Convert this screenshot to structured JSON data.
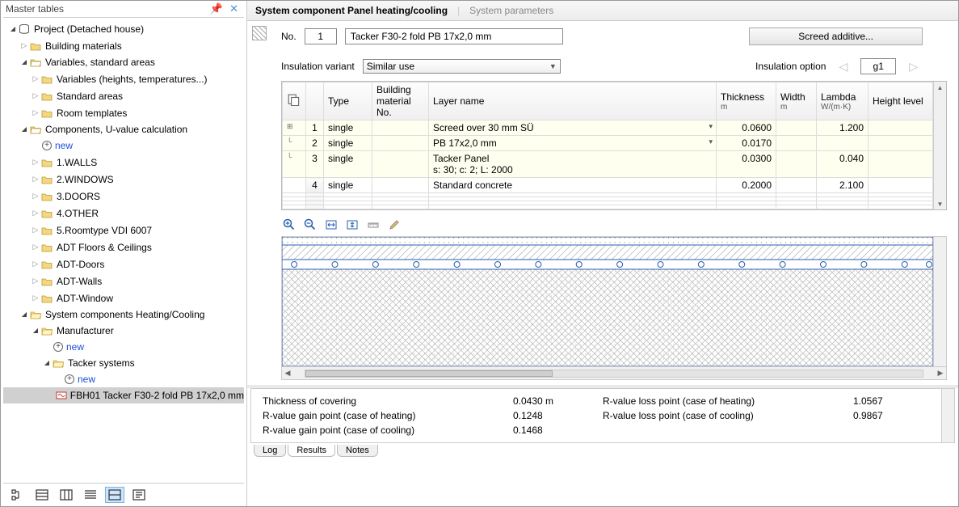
{
  "sidebar": {
    "title": "Master tables",
    "project": "Project (Detached house)",
    "building_materials": "Building materials",
    "variables_std": "Variables, standard areas",
    "variables_heights": "Variables (heights, temperatures...)",
    "standard_areas": "Standard areas",
    "room_templates": "Room templates",
    "components_uval": "Components, U-value calculation",
    "new1": "new",
    "walls": "1.WALLS",
    "windows": "2.WINDOWS",
    "doors": "3.DOORS",
    "other": "4.OTHER",
    "roomtype": "5.Roomtype VDI 6007",
    "adt_floors": "ADT Floors & Ceilings",
    "adt_doors": "ADT-Doors",
    "adt_walls": "ADT-Walls",
    "adt_window": "ADT-Window",
    "sys_comp": "System components Heating/Cooling",
    "manufacturer": "Manufacturer",
    "new2": "new",
    "tacker_systems": "Tacker systems",
    "new3": "new",
    "selected_item": "FBH01 Tacker F30-2 fold PB 17x2,0 mm"
  },
  "tabs": {
    "panel": "System component Panel heating/cooling",
    "params": "System parameters"
  },
  "form": {
    "no_label": "No.",
    "no_value": "1",
    "name_value": "Tacker F30-2 fold PB 17x2,0 mm",
    "screed_btn": "Screed additive...",
    "ins_var_label": "Insulation variant",
    "ins_var_value": "Similar use",
    "ins_opt_label": "Insulation option",
    "ins_opt_value": "g1"
  },
  "grid": {
    "headers": {
      "type": "Type",
      "mat": "Building material No.",
      "layer": "Layer name",
      "thick": "Thickness",
      "thick_u": "m",
      "width": "Width",
      "width_u": "m",
      "lambda": "Lambda",
      "lambda_u": "W/(m·K)",
      "height": "Height level"
    },
    "rows": [
      {
        "n": "1",
        "type": "single",
        "mat": "",
        "layer": "Screed over 30 mm SÜ",
        "thick": "0.0600",
        "width": "",
        "lambda": "1.200",
        "height": "",
        "sel": true,
        "dd": true
      },
      {
        "n": "2",
        "type": "single",
        "mat": "",
        "layer": "PB 17x2,0 mm",
        "thick": "0.0170",
        "width": "",
        "lambda": "",
        "height": "",
        "sel": true,
        "dd": true
      },
      {
        "n": "3",
        "type": "single",
        "mat": "",
        "layer": "Tacker Panel\ns: 30;  c: 2;  L: 2000",
        "thick": "0.0300",
        "width": "",
        "lambda": "0.040",
        "height": "",
        "sel": true
      },
      {
        "n": "4",
        "type": "single",
        "mat": "",
        "layer": "Standard concrete",
        "thick": "0.2000",
        "width": "",
        "lambda": "2.100",
        "height": ""
      }
    ]
  },
  "results": {
    "thick_label": "Thickness of covering",
    "thick_val": "0.0430 m",
    "r_gain_heat_l": "R-value gain point (case of heating)",
    "r_gain_heat_v": "0.1248",
    "r_gain_cool_l": "R-value gain point (case of cooling)",
    "r_gain_cool_v": "0.1468",
    "r_loss_heat_l": "R-value loss point (case of heating)",
    "r_loss_heat_v": "1.0567",
    "r_loss_cool_l": "R-value loss point (case of cooling)",
    "r_loss_cool_v": "0.9867"
  },
  "bottom_tabs": {
    "log": "Log",
    "results": "Results",
    "notes": "Notes"
  }
}
